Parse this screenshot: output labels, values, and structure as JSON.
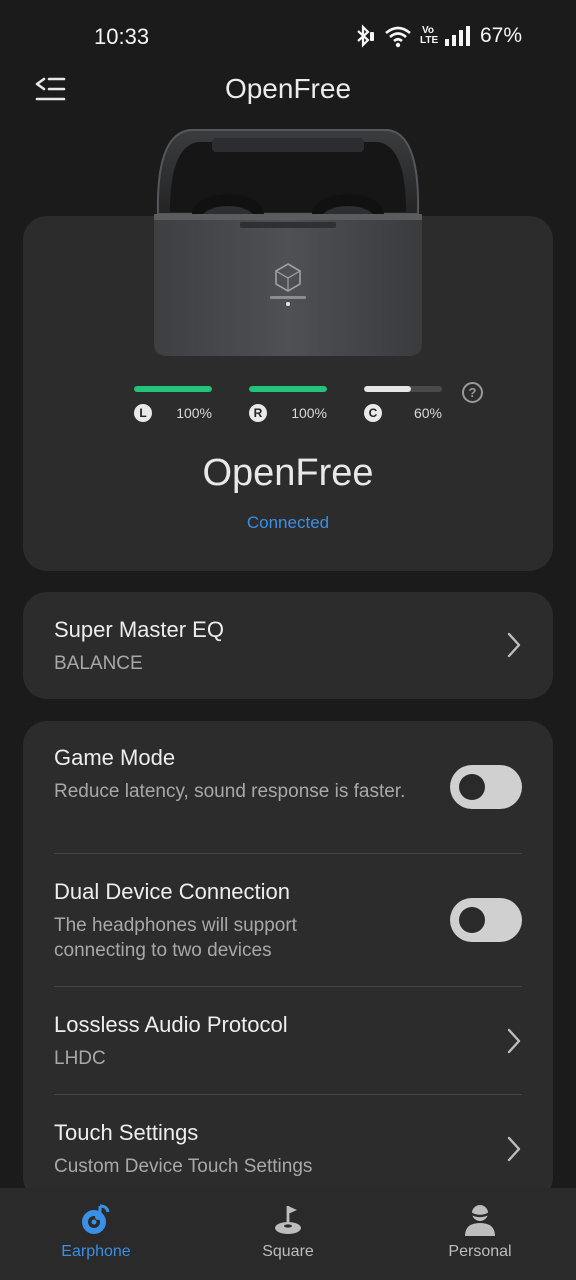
{
  "status_bar": {
    "time": "10:33",
    "battery": "67%",
    "network_badge": "Vo LTE"
  },
  "header": {
    "title": "OpenFree"
  },
  "device": {
    "name": "OpenFree",
    "status": "Connected",
    "batteries": [
      {
        "letter": "L",
        "percent_text": "100%",
        "level": 100,
        "color": "#22c47a"
      },
      {
        "letter": "R",
        "percent_text": "100%",
        "level": 100,
        "color": "#22c47a"
      },
      {
        "letter": "C",
        "percent_text": "60%",
        "level": 60,
        "color": "#e6e6e6"
      }
    ],
    "help_symbol": "?"
  },
  "eq": {
    "title": "Super Master EQ",
    "value": "BALANCE"
  },
  "settings": {
    "game_mode": {
      "title": "Game Mode",
      "desc": "Reduce latency, sound response is faster.",
      "enabled": false
    },
    "dual_device": {
      "title": "Dual Device Connection",
      "desc": "The headphones will support connecting to two devices",
      "enabled": false
    },
    "lossless": {
      "title": "Lossless Audio Protocol",
      "value": "LHDC"
    },
    "touch": {
      "title": "Touch Settings",
      "desc": "Custom Device Touch Settings"
    }
  },
  "nav": {
    "items": [
      {
        "label": "Earphone",
        "icon": "earphone-icon",
        "active": true
      },
      {
        "label": "Square",
        "icon": "square-icon",
        "active": false
      },
      {
        "label": "Personal",
        "icon": "personal-icon",
        "active": false
      }
    ],
    "active_color": "#3a8fe6",
    "inactive_color": "#bdbdbd"
  }
}
